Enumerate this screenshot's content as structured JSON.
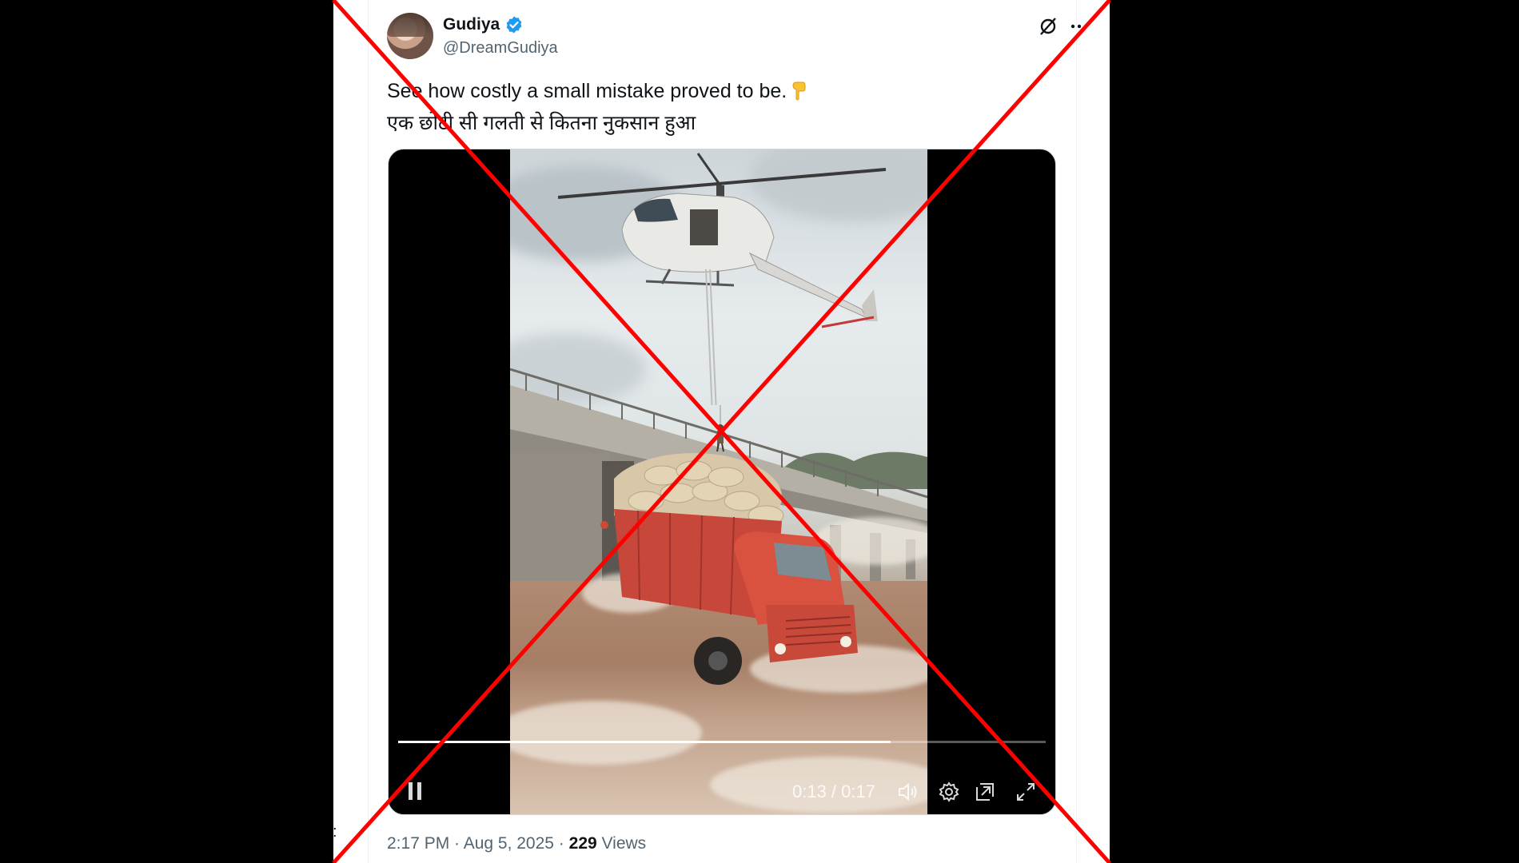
{
  "user": {
    "display_name": "Gudiya",
    "handle": "@DreamGudiya",
    "verified": true,
    "avatar_icon": "avatar-portrait"
  },
  "header_icons": [
    "grok-icon",
    "more-icon"
  ],
  "tweet": {
    "line1": "See how costly a small mistake proved to be.",
    "line1_emoji": "backhand-index-pointing-down-icon",
    "line2": "एक छोटी सी गलती से कितना नुकसान हुआ"
  },
  "video": {
    "time": "0:13 / 0:17",
    "progress": 0.76,
    "controls": [
      "pause-icon",
      "volume-icon",
      "settings-icon",
      "picture-in-picture-icon",
      "fullscreen-icon"
    ]
  },
  "meta": {
    "timestamp": "2:17 PM · Aug 5, 2025 · ",
    "views_count": "229",
    "views_label": " Views"
  },
  "overlay": {
    "cross_color": "#ff0000"
  },
  "colors": {
    "verified": "#1d9bf0",
    "text": "#0f1419",
    "secondary": "#536471"
  }
}
